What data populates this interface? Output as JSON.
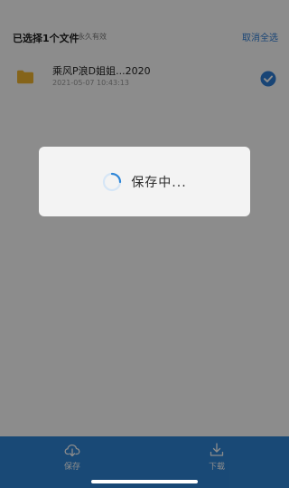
{
  "header": {
    "selected_count_label": "已选择1个文件",
    "validity_label": "永久有效",
    "muted_right_label": "",
    "deselect_all_label": "取消全选"
  },
  "file": {
    "name": "乘风P浪D姐姐...2020",
    "meta": "2021-05-07 10:43:13",
    "icon": "folder-icon",
    "selected": true
  },
  "bottom_bar": {
    "save_label": "保存",
    "download_label": "下载",
    "save_icon": "cloud-save-icon",
    "download_icon": "download-icon"
  },
  "toast": {
    "text": "保存中..."
  },
  "colors": {
    "accent": "#2f86d7",
    "link": "#2f7ed8",
    "folder": "#f3b731",
    "overlay": "rgba(0,0,0,0.45)",
    "toast_bg": "#f3f3f3"
  }
}
